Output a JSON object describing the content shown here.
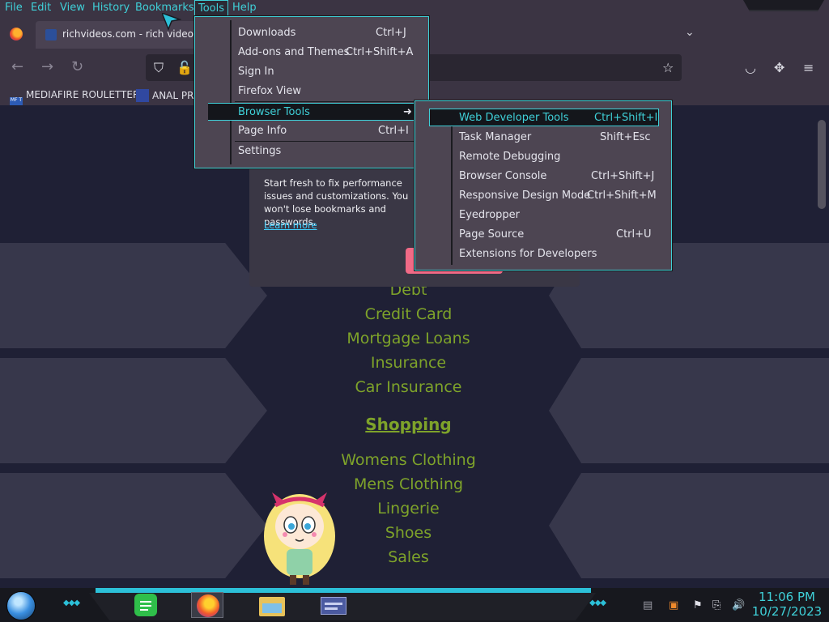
{
  "menubar": {
    "items": [
      "File",
      "Edit",
      "View",
      "History",
      "Bookmarks",
      "Tools",
      "Help"
    ],
    "active": "Tools"
  },
  "tab": {
    "title": "richvideos.com - rich videos Re"
  },
  "bookmarks": [
    {
      "label": "MEDIAFIRE ROULETTER",
      "icon": "mediafire-icon"
    },
    {
      "label": "ANAL PRO",
      "icon": "bookmark-logo-icon"
    }
  ],
  "tools_menu": {
    "items": [
      {
        "label": "Downloads",
        "shortcut": "Ctrl+J"
      },
      {
        "label": "Add-ons and Themes",
        "shortcut": "Ctrl+Shift+A"
      },
      {
        "label": "Sign In",
        "shortcut": ""
      },
      {
        "label": "Firefox View",
        "shortcut": ""
      },
      {
        "label": "Browser Tools",
        "shortcut": "",
        "submenu": true
      },
      {
        "label": "Page Info",
        "shortcut": "Ctrl+I"
      },
      {
        "label": "Settings",
        "shortcut": ""
      }
    ]
  },
  "browser_tools_menu": {
    "items": [
      {
        "label": "Web Developer Tools",
        "shortcut": "Ctrl+Shift+I"
      },
      {
        "label": "Task Manager",
        "shortcut": "Shift+Esc"
      },
      {
        "label": "Remote Debugging",
        "shortcut": ""
      },
      {
        "label": "Browser Console",
        "shortcut": "Ctrl+Shift+J"
      },
      {
        "label": "Responsive Design Mode",
        "shortcut": "Ctrl+Shift+M"
      },
      {
        "label": "Eyedropper",
        "shortcut": ""
      },
      {
        "label": "Page Source",
        "shortcut": "Ctrl+U"
      },
      {
        "label": "Extensions for Developers",
        "shortcut": ""
      }
    ]
  },
  "popup": {
    "text": "Start fresh to fix performance issues and customizations. You won't lose bookmarks and passwords.",
    "learn_more": "Learn more"
  },
  "page_links": {
    "finance": [
      "Debt",
      "Credit Card",
      "Mortgage Loans",
      "Insurance",
      "Car Insurance"
    ],
    "shopping_heading": "Shopping",
    "shopping": [
      "Womens Clothing",
      "Mens Clothing",
      "Lingerie",
      "Shoes",
      "Sales"
    ]
  },
  "taskbar": {
    "time": "11:06 PM",
    "date": "10/27/2023",
    "accent_color": "#2cc0d8"
  },
  "colors": {
    "menu_accent": "#3fd0d8",
    "link_green": "#7ea32a",
    "chrome_bg": "#3b3443"
  }
}
